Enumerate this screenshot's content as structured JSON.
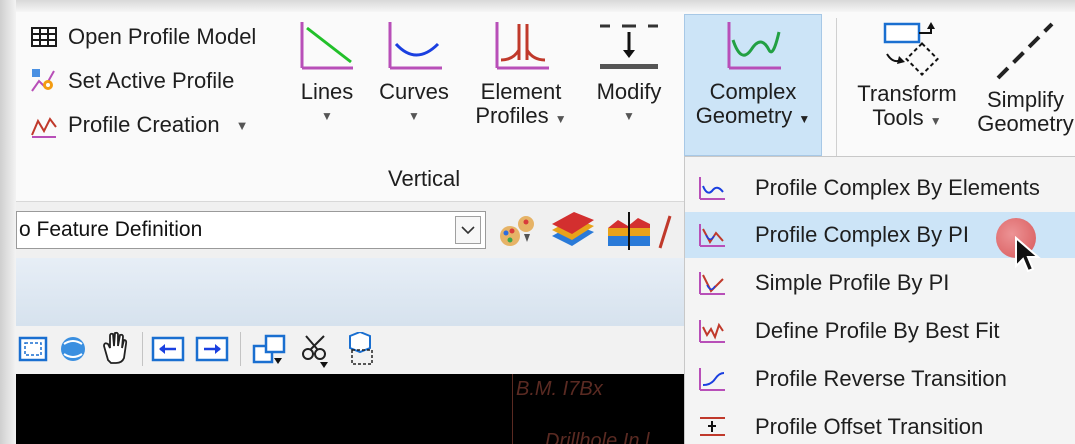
{
  "ribbon": {
    "small_buttons": [
      {
        "label": "Open Profile Model",
        "icon": "grid-icon",
        "has_dropdown": false
      },
      {
        "label": "Set Active Profile",
        "icon": "active-profile-icon",
        "has_dropdown": false
      },
      {
        "label": "Profile Creation",
        "icon": "profile-creation-icon",
        "has_dropdown": true
      }
    ],
    "big_buttons": [
      {
        "line1": "Lines",
        "line2": "",
        "icon": "line-icon"
      },
      {
        "line1": "Curves",
        "line2": "",
        "icon": "curve-icon"
      },
      {
        "line1": "Element",
        "line2": "Profiles",
        "icon": "element-profiles-icon"
      },
      {
        "line1": "Modify",
        "line2": "",
        "icon": "modify-icon"
      },
      {
        "line1": "Complex",
        "line2": "Geometry",
        "icon": "complex-geometry-icon"
      },
      {
        "line1": "Transform",
        "line2": "Tools",
        "icon": "transform-tools-icon"
      },
      {
        "line1": "Simplify",
        "line2": "Geometry",
        "icon": "simplify-geometry-icon"
      }
    ],
    "group_label": "Vertical",
    "dropdown_caret": "▼"
  },
  "feature_combo": {
    "value": "o Feature Definition"
  },
  "viewport": {
    "text1": "B.M. I7Bx",
    "text2": "Drillhole In l"
  },
  "menu": {
    "items": [
      {
        "label": "Profile Complex By Elements",
        "icon": "profile-complex-elements-icon"
      },
      {
        "label": "Profile Complex By PI",
        "icon": "profile-complex-pi-icon"
      },
      {
        "label": "Simple Profile By PI",
        "icon": "simple-profile-pi-icon"
      },
      {
        "label": "Define Profile By Best Fit",
        "icon": "best-fit-icon"
      },
      {
        "label": "Profile Reverse Transition",
        "icon": "reverse-transition-icon"
      },
      {
        "label": "Profile Offset Transition",
        "icon": "offset-transition-icon"
      }
    ],
    "highlighted_index": 1
  },
  "colors": {
    "accent": "#cce4f7",
    "line_green": "#22c02a",
    "curve_blue": "#1a3fe0",
    "profile_red": "#c0392b",
    "magenta": "#b84fb8"
  }
}
